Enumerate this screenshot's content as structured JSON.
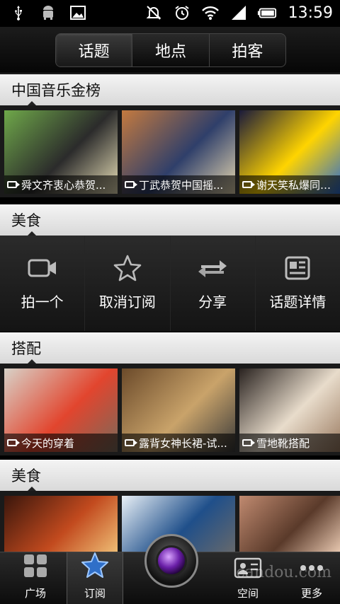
{
  "status": {
    "time": "13:59",
    "icons": [
      "usb-icon",
      "android-icon",
      "image-icon",
      "mute-icon",
      "alarm-icon",
      "wifi-icon",
      "signal-icon",
      "battery-icon"
    ]
  },
  "tabs": [
    {
      "label": "话题",
      "active": true
    },
    {
      "label": "地点",
      "active": false
    },
    {
      "label": "拍客",
      "active": false
    }
  ],
  "sections": [
    {
      "title": "中国音乐金榜",
      "items": [
        {
          "caption": "舜文齐衷心恭贺...",
          "colors": [
            "#6fa84a",
            "#2b2b2b",
            "#e9e0b8"
          ]
        },
        {
          "caption": "丁武恭贺中国摇...",
          "colors": [
            "#c47a3f",
            "#2f3f6a",
            "#e6d7b0"
          ]
        },
        {
          "caption": "谢天笑私爆同男...",
          "colors": [
            "#1a1a3a",
            "#ffd400",
            "#2b6bd1"
          ]
        }
      ]
    },
    {
      "title": "美食",
      "actions": [
        {
          "label": "拍一个",
          "icon": "video-camera-icon"
        },
        {
          "label": "取消订阅",
          "icon": "star-icon"
        },
        {
          "label": "分享",
          "icon": "share-arrows-icon"
        },
        {
          "label": "话题详情",
          "icon": "details-icon"
        }
      ]
    },
    {
      "title": "搭配",
      "items": [
        {
          "caption": "今天的穿着",
          "colors": [
            "#d8d2c8",
            "#e2452e",
            "#7a6a5a"
          ]
        },
        {
          "caption": "露背女神长裙-试...",
          "colors": [
            "#6b4a2a",
            "#c9a36a",
            "#3a3a3a"
          ]
        },
        {
          "caption": "雪地靴搭配",
          "colors": [
            "#2a2320",
            "#e8dccb",
            "#9a7a60"
          ]
        }
      ]
    },
    {
      "title": "美食",
      "items": [
        {
          "caption": "",
          "colors": [
            "#3a160c",
            "#c24a1e",
            "#f1c47a"
          ]
        },
        {
          "caption": "",
          "colors": [
            "#e9f0f6",
            "#1f4f8a",
            "#6a6a6a"
          ]
        },
        {
          "caption": "",
          "colors": [
            "#c08a70",
            "#5a3a2a",
            "#f0d0b8"
          ]
        }
      ]
    }
  ],
  "bottom_nav": [
    {
      "label": "广场",
      "icon": "grid-icon",
      "active": false
    },
    {
      "label": "订阅",
      "icon": "star-icon",
      "active": true
    },
    {
      "label": "空间",
      "icon": "contact-card-icon",
      "active": false
    },
    {
      "label": "更多",
      "icon": "more-dots-icon",
      "active": false
    }
  ],
  "watermark": "candou.com"
}
